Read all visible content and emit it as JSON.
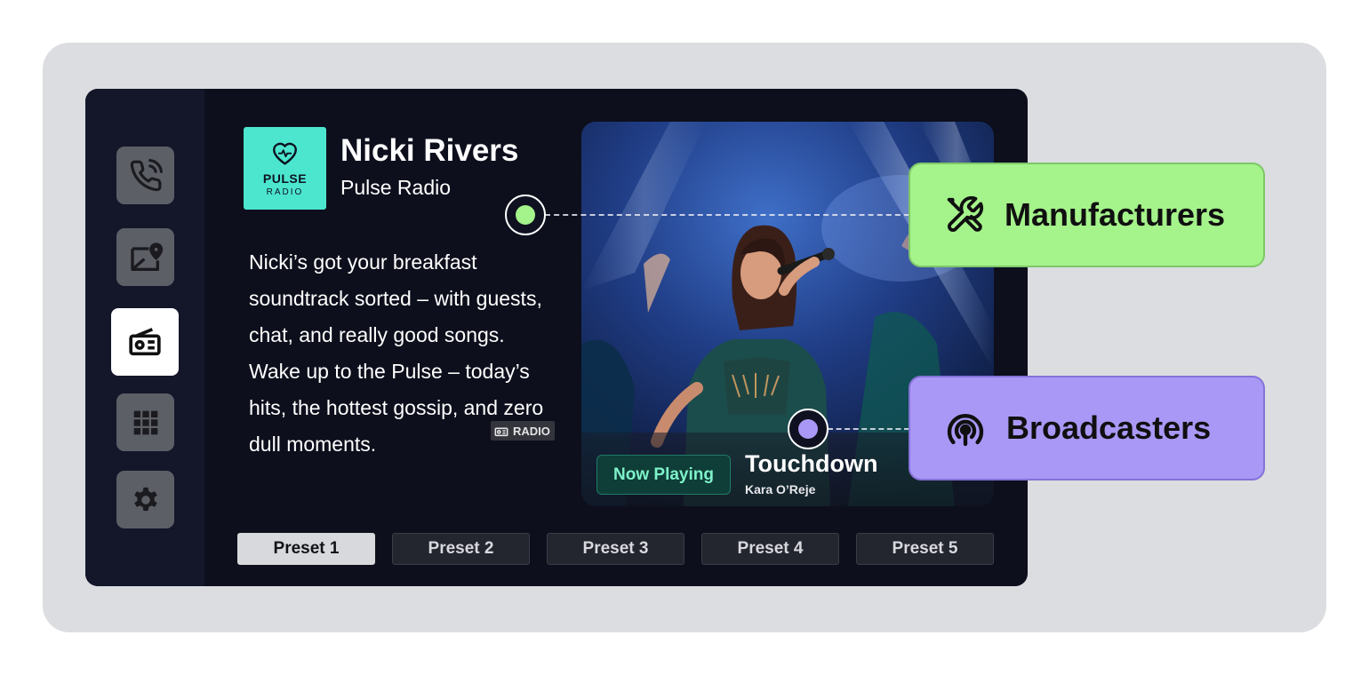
{
  "nav": {
    "items": [
      {
        "icon": "phone-call-icon"
      },
      {
        "icon": "map-pin-icon"
      },
      {
        "icon": "radio-icon",
        "active": true
      },
      {
        "icon": "apps-grid-icon"
      },
      {
        "icon": "gear-icon"
      }
    ]
  },
  "station": {
    "logo_line1": "PULSE",
    "logo_line2": "RADIO",
    "host": "Nicki Rivers",
    "name": "Pulse Radio",
    "description": "Nicki’s got your breakfast soundtrack sorted – with guests, chat, and really good songs. Wake up to the Pulse – today’s hits, the hottest gossip, and zero dull moments."
  },
  "radio_tag": {
    "label": "RADIO"
  },
  "now_playing": {
    "badge": "Now Playing",
    "title": "Touchdown",
    "artist": "Kara O’Reje"
  },
  "presets": [
    {
      "label": "Preset 1",
      "active": true
    },
    {
      "label": "Preset 2"
    },
    {
      "label": "Preset 3"
    },
    {
      "label": "Preset 4"
    },
    {
      "label": "Preset 5"
    }
  ],
  "callouts": {
    "manufacturers": {
      "label": "Manufacturers",
      "icon": "tools-icon",
      "color": "#a5f38b",
      "dot_color": "#a5f38b"
    },
    "broadcasters": {
      "label": "Broadcasters",
      "icon": "broadcast-icon",
      "color": "#aa98f6",
      "dot_color": "#aa98f6"
    }
  },
  "colors": {
    "screen_bg": "#0d0f1c",
    "logo_bg": "#4ce6cf",
    "badge_text": "#7ef2c9"
  }
}
